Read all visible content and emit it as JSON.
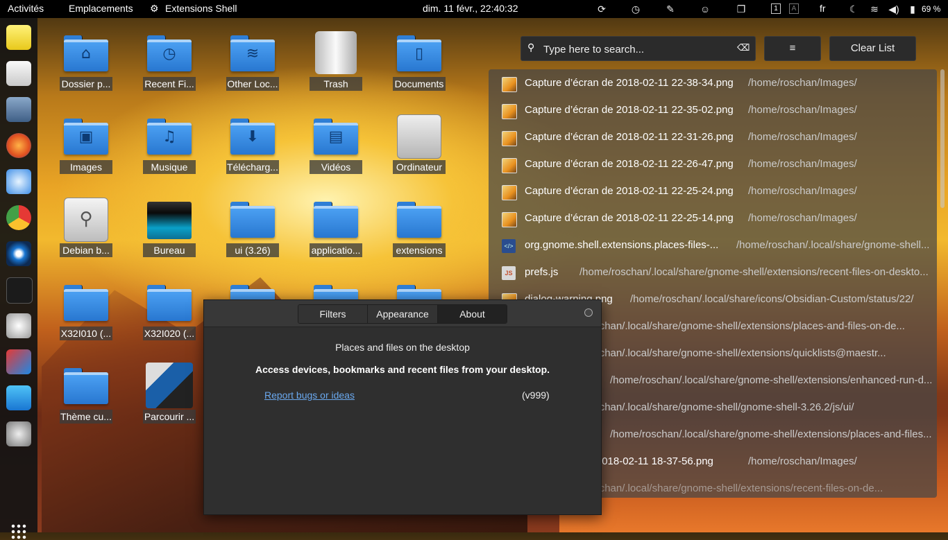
{
  "topbar": {
    "activities": "Activités",
    "places": "Emplacements",
    "app_name": "Extensions Shell",
    "clock": "dim. 11 févr., 22:40:32",
    "workspace_1": "1",
    "workspace_2": "A",
    "keyboard": "fr",
    "battery": "69 %"
  },
  "desktop_icons": [
    {
      "label": "Dossier p..."
    },
    {
      "label": "Recent Fi..."
    },
    {
      "label": "Other Loc..."
    },
    {
      "label": "Trash"
    },
    {
      "label": "Documents"
    },
    {
      "label": "Images"
    },
    {
      "label": "Musique"
    },
    {
      "label": "Télécharg..."
    },
    {
      "label": "Vidéos"
    },
    {
      "label": "Ordinateur"
    },
    {
      "label": "Debian b..."
    },
    {
      "label": "Bureau"
    },
    {
      "label": "ui (3.26)"
    },
    {
      "label": "applicatio..."
    },
    {
      "label": "extensions"
    },
    {
      "label": "X32I010 (..."
    },
    {
      "label": "X32I020 (..."
    },
    {
      "label": "Thème cu..."
    },
    {
      "label": "Parcourir ..."
    }
  ],
  "search": {
    "placeholder": "Type here to search..."
  },
  "menu_button": "≡",
  "clear_button": "Clear List",
  "recent_files": [
    {
      "name": "Capture d’écran de 2018-02-11 22-38-34.png",
      "path": "/home/roschan/Images/"
    },
    {
      "name": "Capture d’écran de 2018-02-11 22-35-02.png",
      "path": "/home/roschan/Images/"
    },
    {
      "name": "Capture d’écran de 2018-02-11 22-31-26.png",
      "path": "/home/roschan/Images/"
    },
    {
      "name": "Capture d’écran de 2018-02-11 22-26-47.png",
      "path": "/home/roschan/Images/"
    },
    {
      "name": "Capture d’écran de 2018-02-11 22-25-24.png",
      "path": "/home/roschan/Images/"
    },
    {
      "name": "Capture d’écran de 2018-02-11 22-25-14.png",
      "path": "/home/roschan/Images/"
    },
    {
      "name": "org.gnome.shell.extensions.places-files-...",
      "path": "/home/roschan/.local/share/gnome-shell..."
    },
    {
      "name": "prefs.js",
      "path": "/home/roschan/.local/share/gnome-shell/extensions/recent-files-on-deskto..."
    },
    {
      "name": "dialog-warning.png",
      "path": "/home/roschan/.local/share/icons/Obsidian-Custom/status/22/"
    },
    {
      "name": "",
      "path": "/home/roschan/.local/share/gnome-shell/extensions/places-and-files-on-de..."
    },
    {
      "name": "",
      "path": "/home/roschan/.local/share/gnome-shell/extensions/quicklists@maestr..."
    },
    {
      "name": "",
      "path": "/home/roschan/.local/share/gnome-shell/extensions/enhanced-run-d..."
    },
    {
      "name": "",
      "path": "/home/roschan/.local/share/gnome-shell/gnome-shell-3.26.2/js/ui/"
    },
    {
      "name": "",
      "path": "/home/roschan/.local/share/gnome-shell/extensions/places-and-files..."
    },
    {
      "name": "de 2018-02-11 18-37-56.png",
      "path": "/home/roschan/Images/"
    },
    {
      "name": "",
      "path": "/home/roschan/.local/share/gnome-shell/extensions/recent-files-on-de..."
    }
  ],
  "dialog": {
    "tabs": [
      "Filters",
      "Appearance",
      "About"
    ],
    "active_tab": "About",
    "title": "Places and files on the desktop",
    "description": "Access devices, bookmarks and recent files from your desktop.",
    "link": "Report bugs or ideas",
    "version": "(v999)"
  }
}
